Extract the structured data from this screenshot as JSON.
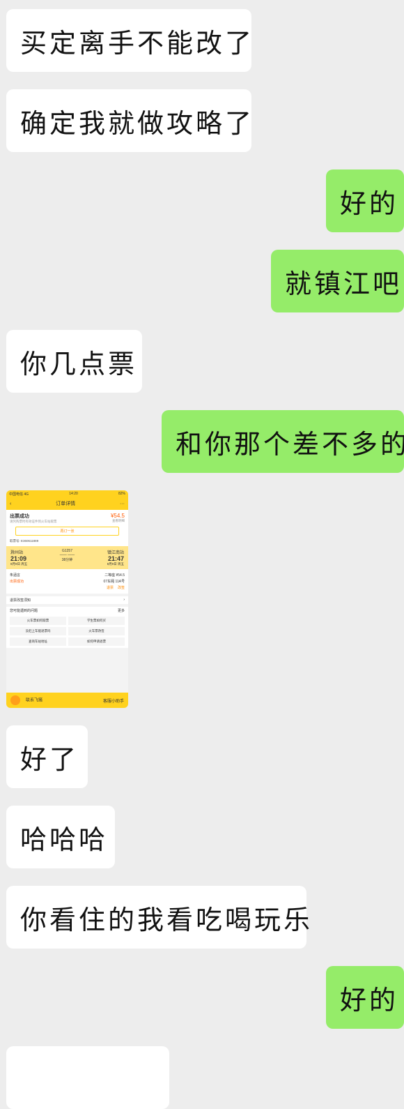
{
  "messages": [
    {
      "side": "left",
      "text": "买定离手不能改了"
    },
    {
      "side": "left",
      "text": "确定我就做攻略了"
    },
    {
      "side": "right",
      "text": "好的"
    },
    {
      "side": "right",
      "text": "就镇江吧"
    },
    {
      "side": "left",
      "text": "你几点票"
    },
    {
      "side": "right",
      "text": "和你那个差不多的"
    },
    {
      "side": "left",
      "text": "好了"
    },
    {
      "side": "left",
      "text": "哈哈哈"
    },
    {
      "side": "left",
      "text": "你看住的我看吃喝玩乐"
    },
    {
      "side": "right",
      "text": "好的"
    }
  ],
  "screenshot": {
    "carrier": "中国电信 4G",
    "time": "14:20",
    "battery": "82%",
    "title": "订单详情",
    "status": "出票成功",
    "status_note": "请凭购票时有效证件到火车站取票",
    "price": "¥54.5",
    "price_note": "查看明细",
    "rebook": "再订一张",
    "order_no": "取票号: E360611889",
    "from": "滁州站",
    "to": "镇江南站",
    "train": "G1257",
    "dep_time": "21:09",
    "arr_time": "21:47",
    "dep_date": "8月9日 周五",
    "arr_date": "8月9日 周五",
    "duration": "38分钟",
    "passenger": "朱涵言",
    "seat_class": "二等座 ¥54.5",
    "seat": "07车厢 11A号",
    "ticket_status": "出票成功",
    "refund": "退票",
    "change": "改签",
    "rules": "退票改签须知",
    "faq": "您可能遇到的问题",
    "more": "更多",
    "faq_items": [
      "火车票如何取票",
      "学生票如何买",
      "没赶上车能退票吗",
      "火车票改签",
      "查询车站地址",
      "如何申请退票"
    ],
    "contact": "联系飞猪",
    "assistant": "客服小助手"
  },
  "colors": {
    "self_bubble": "#95ec69",
    "other_bubble": "#ffffff",
    "background": "#ededed"
  }
}
